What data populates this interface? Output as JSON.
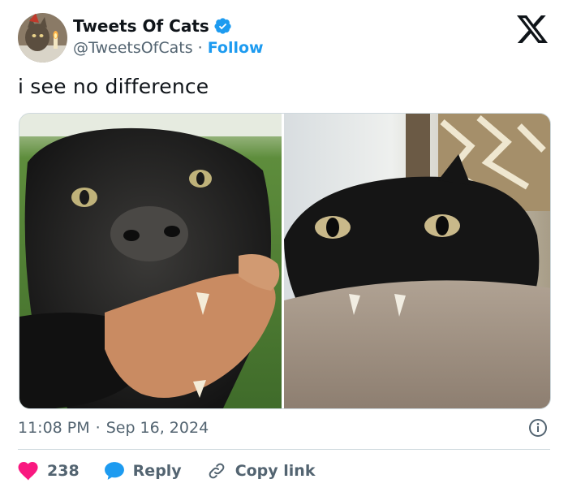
{
  "author": {
    "name": "Tweets Of Cats",
    "handle": "@TweetsOfCats",
    "separator": "·",
    "follow_label": "Follow"
  },
  "tweet": {
    "text": "i see no difference"
  },
  "meta": {
    "time": "11:08 PM",
    "separator": "·",
    "date": "Sep 16, 2024"
  },
  "actions": {
    "like_count": "238",
    "reply_label": "Reply",
    "copy_label": "Copy link"
  },
  "icons": {
    "verified": "verified-badge-icon",
    "platform": "x-logo-icon",
    "info": "info-icon",
    "like": "heart-icon",
    "reply": "speech-bubble-icon",
    "copy": "link-icon"
  },
  "colors": {
    "accent": "#1d9bf0",
    "like": "#f91880",
    "muted": "#536471",
    "text": "#0f1419",
    "border": "#cfd9de"
  }
}
